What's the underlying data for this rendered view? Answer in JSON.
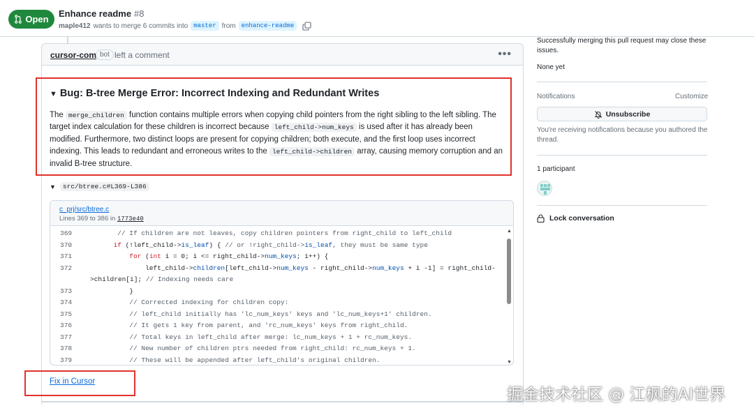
{
  "header": {
    "status": "Open",
    "title": "Enhance readme",
    "number": "#8",
    "author": "maple412",
    "merge_text": "wants to merge 6 commits into",
    "base_branch": "master",
    "from_text": "from",
    "head_branch": "enhance-readme"
  },
  "comment": {
    "author": "cursor-com",
    "badge": "bot",
    "action": "left a comment",
    "menu": "•••",
    "bug_title": "Bug: B-tree Merge Error: Incorrect Indexing and Redundant Writes",
    "desc": {
      "p1": "The ",
      "c1": "merge_children",
      "p2": " function contains multiple errors when copying child pointers from the right sibling to the left sibling. The target index calculation for these children is incorrect because ",
      "c2": "left_child->num_keys",
      "p3": " is used after it has already been modified. Furthermore, two distinct loops are present for copying children; both execute, and the first loop uses incorrect indexing. This leads to redundant and erroneous writes to the ",
      "c3": "left_child->children",
      "p4": " array, causing memory corruption and an invalid B-tree structure."
    },
    "file_ref": "src/btree.c#L369-L386",
    "code_file": "c_prj/src/btree.c",
    "lines_text": "Lines 369 to 386 in",
    "sha": "1773e40",
    "fix_link": "Fix in Cursor"
  },
  "code_lines": [
    {
      "n": "369",
      "t": "// If children are not leaves, copy children pointers from right_child to left_child"
    },
    {
      "n": "370",
      "t": "if (!left_child->is_leaf) { // or !right_child->is_leaf, they must be same type"
    },
    {
      "n": "371",
      "t": "for (int i = 0; i <= right_child->num_keys; i++) {"
    },
    {
      "n": "372",
      "t": "left_child->children[left_child->num_keys - right_child->num_keys + i -1] = right_child-"
    },
    {
      "n": "",
      "t": ">children[i]; // Indexing needs care"
    },
    {
      "n": "373",
      "t": "}"
    },
    {
      "n": "374",
      "t": "// Corrected indexing for children copy:"
    },
    {
      "n": "375",
      "t": "// left_child initially has 'lc_num_keys' keys and 'lc_num_keys+1' children."
    },
    {
      "n": "376",
      "t": "// It gets 1 key from parent, and 'rc_num_keys' keys from right_child."
    },
    {
      "n": "377",
      "t": "// Total keys in left_child after merge: lc_num_keys + 1 + rc_num_keys."
    },
    {
      "n": "378",
      "t": "// New number of children ptrs needed from right_child: rc_num_keys + 1."
    },
    {
      "n": "379",
      "t": "// These will be appended after left_child's original children."
    }
  ],
  "sidebar": {
    "merge_note": "Successfully merging this pull request may close these issues.",
    "none_yet": "None yet",
    "notifications": "Notifications",
    "customize": "Customize",
    "unsubscribe": "Unsubscribe",
    "notif_reason": "You're receiving notifications because you authored the thread.",
    "participants": "1 participant",
    "lock": "Lock conversation"
  },
  "watermark": "掘金技术社区 @ 江枫的AI世界",
  "colors": {
    "open_green": "#1f883d",
    "link_blue": "#0969da",
    "highlight_red": "#e0312b"
  }
}
